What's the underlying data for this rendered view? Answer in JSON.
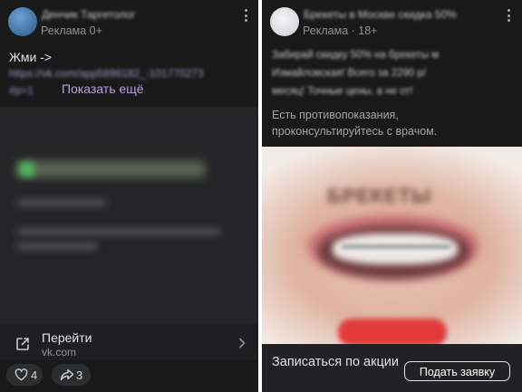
{
  "left_post": {
    "author": "Денчик Таргетолог",
    "ad_label": "Реклама 0+",
    "text": "Жми ->",
    "link_line1": "https://vk.com/app5898182_-101770273",
    "link_line2": "#p=1",
    "show_more": "Показать ещё",
    "media": {
      "blurred_button": "Зарегистрироваться",
      "blurred_caption": "ВК таргетолог",
      "blurred_text_1": "Узнайте как настроить рекламу",
      "blurred_text_2": "быстро и просто"
    },
    "link": {
      "title": "Перейти",
      "domain": "vk.com"
    },
    "likes": "4",
    "shares": "3"
  },
  "right_post": {
    "author": "Брекеты в Москве скидка 50%",
    "ad_label": "Реклама · 18+",
    "text_line1": "Забирай скидку 50% на брекеты м",
    "text_line2": "Измайловская! Всего за 2290 р/",
    "text_line3": "месяц! Точные цены, а не от!",
    "disclaimer": "Есть противопоказания, проконсультируйтесь с врачом.",
    "media": {
      "brand_word": "БРЕКЕТЫ",
      "cta_blur": "Записаться"
    },
    "cta_text": "Записаться по акции",
    "cta_button": "Подать заявку"
  }
}
